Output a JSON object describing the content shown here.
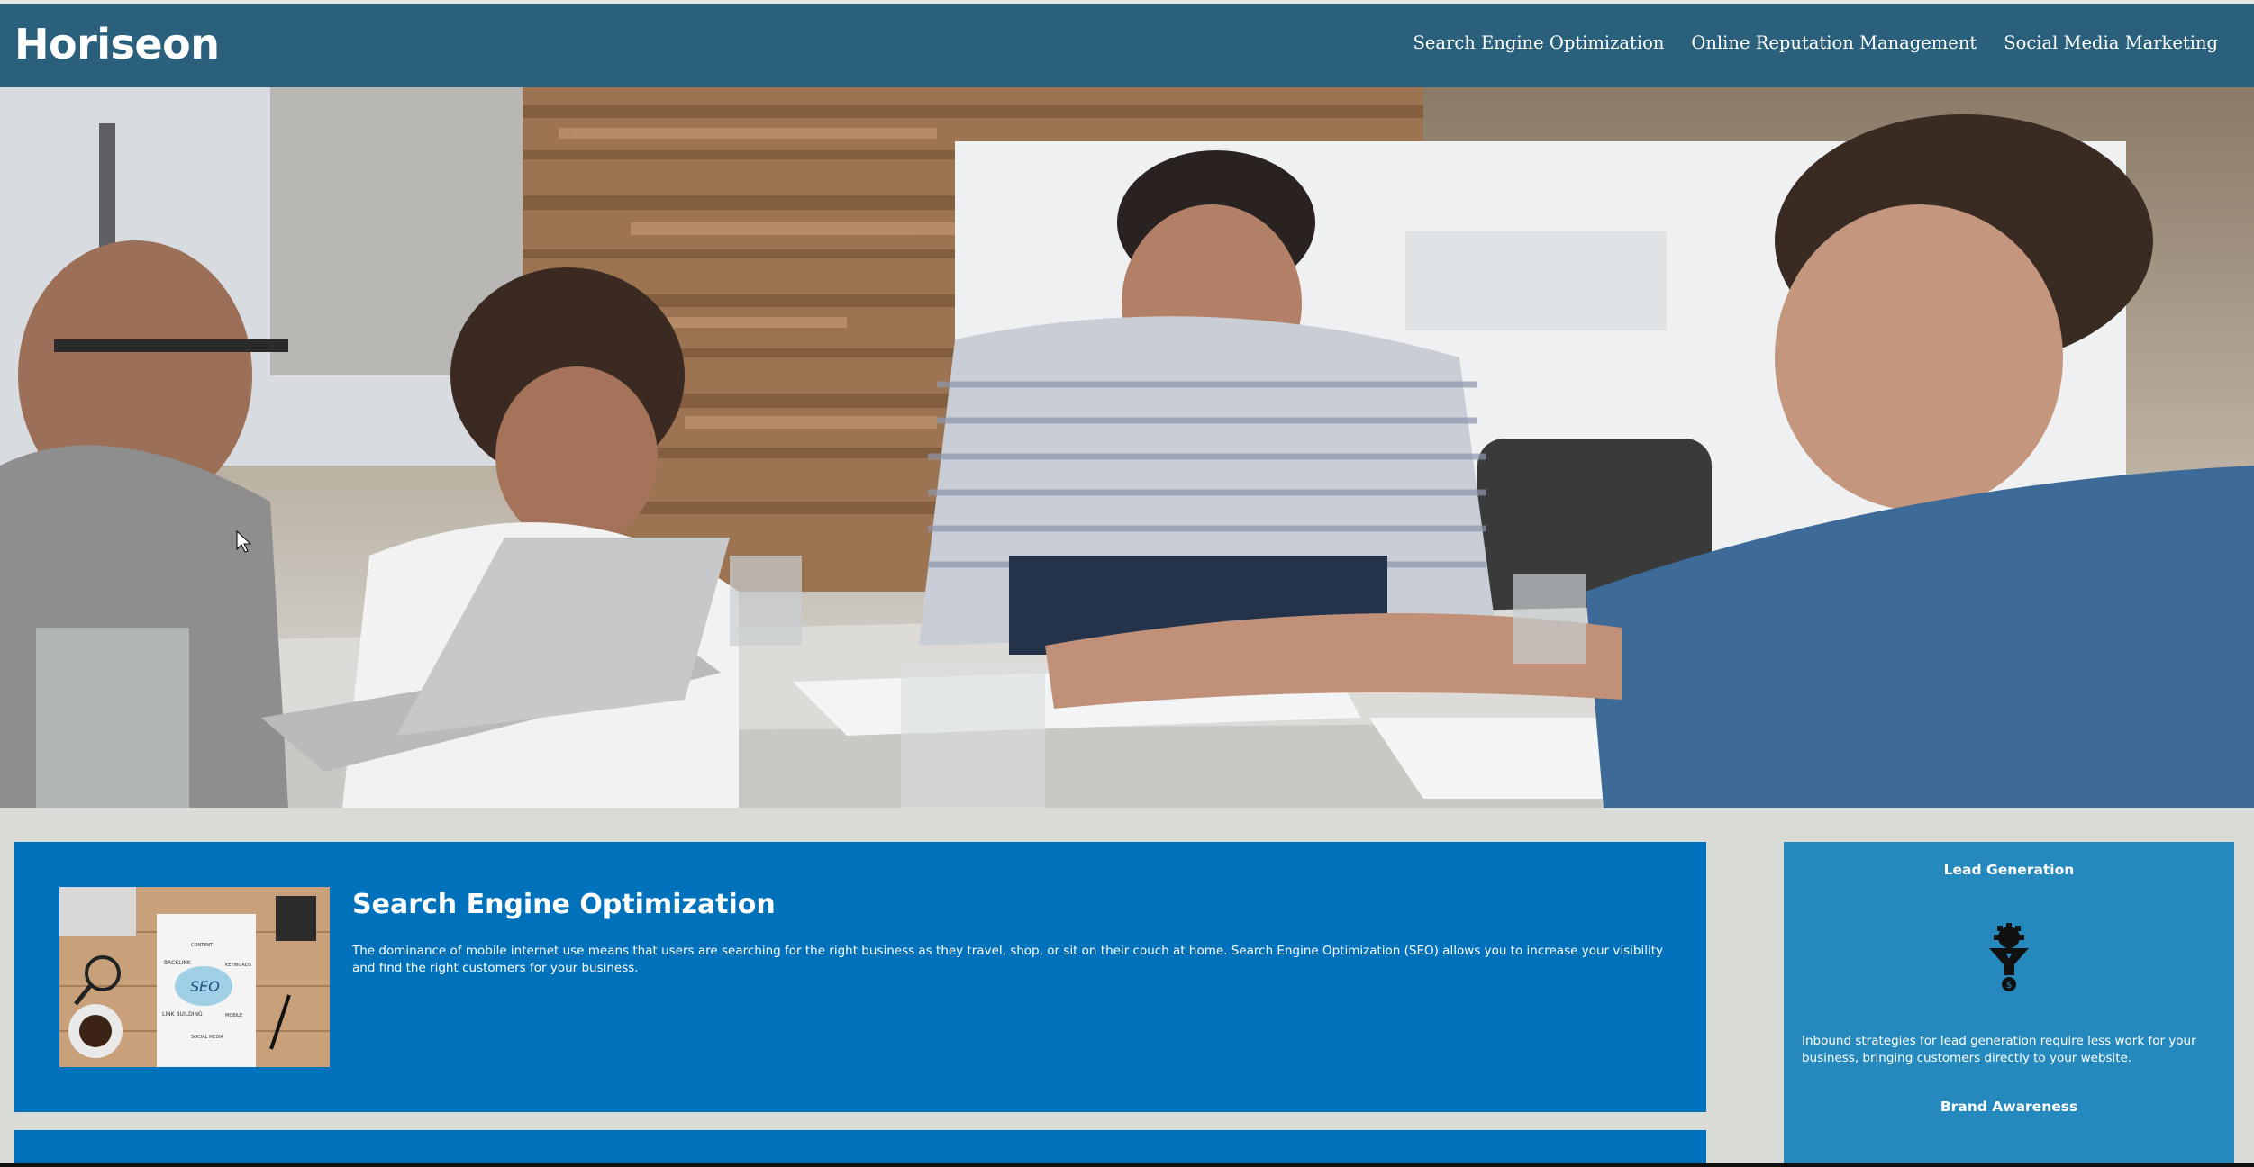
{
  "brand": {
    "logo": "Horiseon"
  },
  "nav": {
    "items": [
      {
        "label": "Search Engine Optimization"
      },
      {
        "label": "Online Reputation Management"
      },
      {
        "label": "Social Media Marketing"
      }
    ]
  },
  "seo": {
    "title": "Search Engine Optimization",
    "text": "The dominance of mobile internet use means that users are searching for the right business as they travel, shop, or sit on their couch at home. Search Engine Optimization (SEO) allows you to increase your visibility and find the right customers for your business.",
    "image_labels": [
      "SEO",
      "CONTENT",
      "BACKLINK",
      "KEYWORDS",
      "LINK BUILDING",
      "MOBILE",
      "SOCIAL MEDIA"
    ]
  },
  "sidebar": {
    "lead": {
      "title": "Lead Generation",
      "icon": "lead-generation-funnel-gear-icon",
      "text": "Inbound strategies for lead generation require less work for your business, bringing customers directly to your website."
    },
    "brand": {
      "title": "Brand Awareness",
      "icon": "brand-awareness-icon"
    }
  },
  "colors": {
    "header": "#2a607c",
    "card": "#0072bb",
    "sidebar": "#2589bd",
    "page": "#d9dcd6"
  }
}
